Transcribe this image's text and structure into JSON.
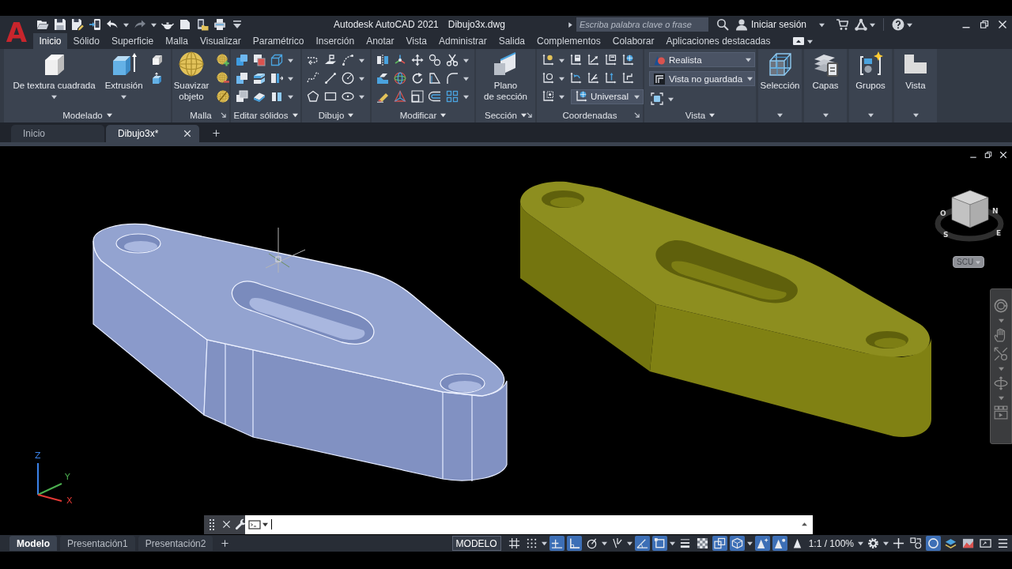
{
  "title_bar": {
    "logo": "A",
    "app_title": "Autodesk AutoCAD 2021",
    "file_name": "Dibujo3x.dwg",
    "search": {
      "placeholder": "Escriba palabra clave o frase"
    },
    "sign_in": "Iniciar sesión"
  },
  "ribbon_tabs": [
    {
      "label": "Inicio",
      "selected": true
    },
    {
      "label": "Sólido",
      "selected": false
    },
    {
      "label": "Superficie",
      "selected": false
    },
    {
      "label": "Malla",
      "selected": false
    },
    {
      "label": "Visualizar",
      "selected": false
    },
    {
      "label": "Paramétrico",
      "selected": false
    },
    {
      "label": "Inserción",
      "selected": false
    },
    {
      "label": "Anotar",
      "selected": false
    },
    {
      "label": "Vista",
      "selected": false
    },
    {
      "label": "Administrar",
      "selected": false
    },
    {
      "label": "Salida",
      "selected": false
    },
    {
      "label": "Complementos",
      "selected": false
    },
    {
      "label": "Colaborar",
      "selected": false
    },
    {
      "label": "Aplicaciones destacadas",
      "selected": false
    }
  ],
  "ribbon_panels": [
    {
      "kind": "large",
      "title": "Modelado",
      "menu": true,
      "launcher": false,
      "buttons": [
        {
          "label": "De textura cuadrada",
          "menu": true
        },
        {
          "label": "Extrusión",
          "menu": true
        }
      ]
    },
    {
      "kind": "large",
      "title": "Malla",
      "menu": false,
      "launcher": true,
      "buttons": [
        {
          "label": "Suavizar objeto",
          "menu": false
        }
      ]
    },
    {
      "kind": "grid",
      "title": "Editar sólidos",
      "menu": true,
      "launcher": false
    },
    {
      "kind": "grid",
      "title": "Dibujo",
      "menu": true,
      "launcher": false
    },
    {
      "kind": "grid",
      "title": "Modificar",
      "menu": true,
      "launcher": false
    },
    {
      "kind": "large",
      "title": "Sección",
      "menu": true,
      "launcher": true,
      "buttons": [
        {
          "label": "Plano\nde sección",
          "menu": false
        }
      ]
    },
    {
      "kind": "grid",
      "title": "Coordenadas",
      "menu": false,
      "launcher": true,
      "dropdowns": [
        {
          "value": "Universal"
        }
      ]
    },
    {
      "kind": "dropdowns",
      "title": "Vista",
      "menu": true,
      "launcher": false,
      "dropdowns": [
        {
          "value": "Realista"
        },
        {
          "value": "Vista no guardada"
        }
      ]
    },
    {
      "kind": "single",
      "buttons": [
        {
          "label": "Selección",
          "menu": true
        }
      ]
    },
    {
      "kind": "single",
      "buttons": [
        {
          "label": "Capas",
          "menu": true
        }
      ]
    },
    {
      "kind": "single",
      "buttons": [
        {
          "label": "Grupos",
          "menu": true
        }
      ]
    },
    {
      "kind": "single",
      "buttons": [
        {
          "label": "Vista",
          "menu": true
        }
      ]
    }
  ],
  "file_tabs": [
    {
      "label": "Inicio",
      "selected": false,
      "closable": false
    },
    {
      "label": "Dibujo3x*",
      "selected": true,
      "closable": true
    }
  ],
  "viewport": {
    "view_cube": {
      "compass": [
        "O",
        "N",
        "S",
        "E"
      ]
    },
    "ucs_menu": "SCU",
    "ucs_icon": {
      "axes": [
        "Z",
        "Y",
        "X"
      ]
    }
  },
  "layout_tabs": [
    {
      "label": "Modelo",
      "selected": true
    },
    {
      "label": "Presentación1",
      "selected": false
    },
    {
      "label": "Presentación2",
      "selected": false
    }
  ],
  "status_bar": {
    "mode": "MODELO",
    "annotation_scale": "1:1 / 100%",
    "toggles": [
      {
        "on": false
      },
      {
        "on": false
      },
      {
        "on": true
      },
      {
        "on": true
      },
      {
        "on": false
      },
      {
        "on": false
      },
      {
        "on": true
      },
      {
        "on": true
      },
      {
        "on": false
      },
      {
        "on": false
      },
      {
        "on": true
      },
      {
        "on": true
      },
      {
        "on": true
      },
      {
        "on": true
      },
      {
        "on": false
      },
      {
        "on": false
      },
      {
        "on": false
      },
      {
        "on": false
      },
      {
        "on": true
      },
      {
        "on": false
      },
      {
        "on": false
      },
      {
        "on": false
      },
      {
        "on": false
      }
    ]
  }
}
